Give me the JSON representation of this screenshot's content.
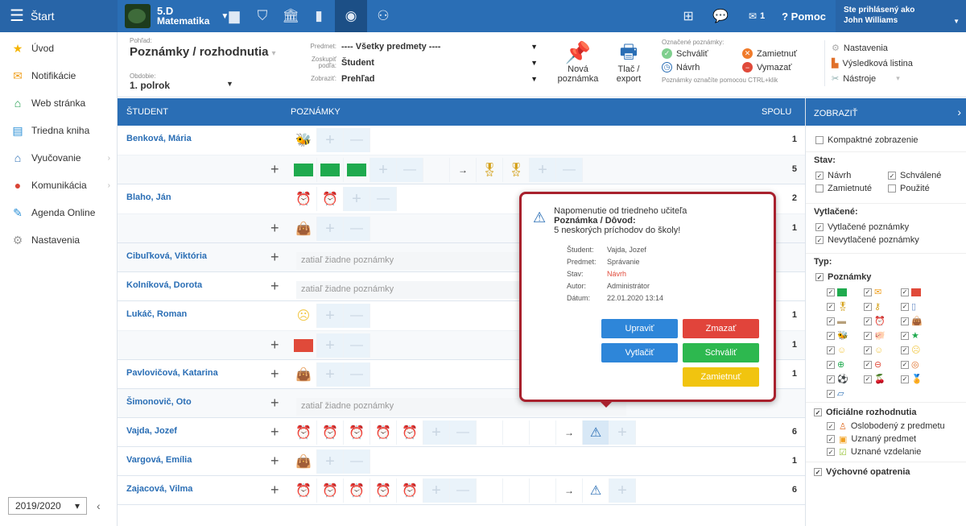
{
  "topbar": {
    "start_label": "Štart",
    "class_name": "5.D",
    "subject": "Matematika",
    "messages_count": "1",
    "help_label": "? Pomoc",
    "user_prefix": "Ste prihlásený ako",
    "user_name": "John Williams"
  },
  "sidebar": {
    "items": [
      {
        "label": "Úvod",
        "icon": "star-icon"
      },
      {
        "label": "Notifikácie",
        "icon": "envelope-icon"
      },
      {
        "label": "Web stránka",
        "icon": "home-icon"
      },
      {
        "label": "Triedna kniha",
        "icon": "book-icon"
      },
      {
        "label": "Vyučovanie",
        "icon": "school-icon"
      },
      {
        "label": "Komunikácia",
        "icon": "chat-icon"
      },
      {
        "label": "Agenda Online",
        "icon": "pencil-icon"
      },
      {
        "label": "Nastavenia",
        "icon": "gear-icon"
      }
    ],
    "year": "2019/2020"
  },
  "filter": {
    "pohlad_label": "Pohľad:",
    "pohlad_value": "Poznámky / rozhodnutia",
    "obdobie_label": "Obdobie:",
    "obdobie_value": "1. polrok",
    "predmet_label": "Predmet:",
    "predmet_value": "---- Všetky predmety ----",
    "zoskupit_label": "Zoskupiť podľa:",
    "zoskupit_value": "Študent",
    "zobrazit_label": "Zobraziť:",
    "zobrazit_value": "Prehľad",
    "new_note_label": "Nová poznámka",
    "print_label": "Tlač / export",
    "marked_label": "Označené poznámky:",
    "approve_label": "Schváliť",
    "reject_label": "Zamietnuť",
    "draft_label": "Návrh",
    "delete_label": "Vymazať",
    "hint": "Poznámky označíte pomocou CTRL+klik",
    "settings_label": "Nastavenia",
    "results_label": "Výsledková listina",
    "tools_label": "Nástroje"
  },
  "table": {
    "col_student": "Študent",
    "col_notes": "Poznámky",
    "col_total": "Spolu",
    "empty_text": "zatiaľ žiadne poznámky",
    "students": [
      {
        "name": "Benková, Mária",
        "totals": [
          "1",
          "5"
        ]
      },
      {
        "name": "Blaho, Ján",
        "totals": [
          "2",
          "1"
        ]
      },
      {
        "name": "Cibuľková, Viktória",
        "totals": []
      },
      {
        "name": "Kolníková, Dorota",
        "totals": []
      },
      {
        "name": "Lukáč, Roman",
        "totals": [
          "1",
          "1"
        ]
      },
      {
        "name": "Pavlovičová, Katarina",
        "totals": [
          "1"
        ]
      },
      {
        "name": "Šimonovič, Oto",
        "totals": []
      },
      {
        "name": "Vajda, Jozef",
        "totals": [
          "6"
        ]
      },
      {
        "name": "Vargová, Emília",
        "totals": [
          "1"
        ]
      },
      {
        "name": "Zajacová, Vilma",
        "totals": [
          "6"
        ]
      }
    ]
  },
  "popup": {
    "title": "Napomenutie od triedneho učiteľa",
    "subtitle": "Poznámka / Dôvod:",
    "reason": "5 neskorých príchodov do školy!",
    "k_student": "Študent:",
    "v_student": "Vajda, Jozef",
    "k_predmet": "Predmet:",
    "v_predmet": "Správanie",
    "k_stav": "Stav:",
    "v_stav": "Návrh",
    "k_autor": "Autor:",
    "v_autor": "Administrátor",
    "k_datum": "Dátum:",
    "v_datum": "22.01.2020 13:14",
    "edit": "Upraviť",
    "delete": "Zmazať",
    "print": "Vytlačiť",
    "approve": "Schváliť",
    "reject": "Zamietnuť"
  },
  "panel": {
    "title": "Zobraziť",
    "compact": "Kompaktné zobrazenie",
    "stav": "Stav:",
    "navrh": "Návrh",
    "schvalene": "Schválené",
    "zamietnute": "Zamietnuté",
    "pouzite": "Použité",
    "vytlacene": "Vytlačené:",
    "vytlacene_pozn": "Vytlačené poznámky",
    "nevytlacene_pozn": "Nevytlačené poznámky",
    "typ": "Typ:",
    "poznamky": "Poznámky",
    "oficialne": "Oficiálne rozhodnutia",
    "oslobodeny": "Oslobodený z predmetu",
    "uznany": "Uznaný predmet",
    "uznane_vzd": "Uznané vzdelanie",
    "vychovne": "Výchovné opatrenia"
  },
  "colors": {
    "primary": "#2a6eb5",
    "green": "#1faa4e",
    "red": "#e04a3a",
    "popup_border": "#a8212d",
    "btn_blue": "#2e86d9",
    "btn_red": "#e1443b",
    "btn_green": "#2db84f",
    "btn_yellow": "#f1c40f"
  }
}
